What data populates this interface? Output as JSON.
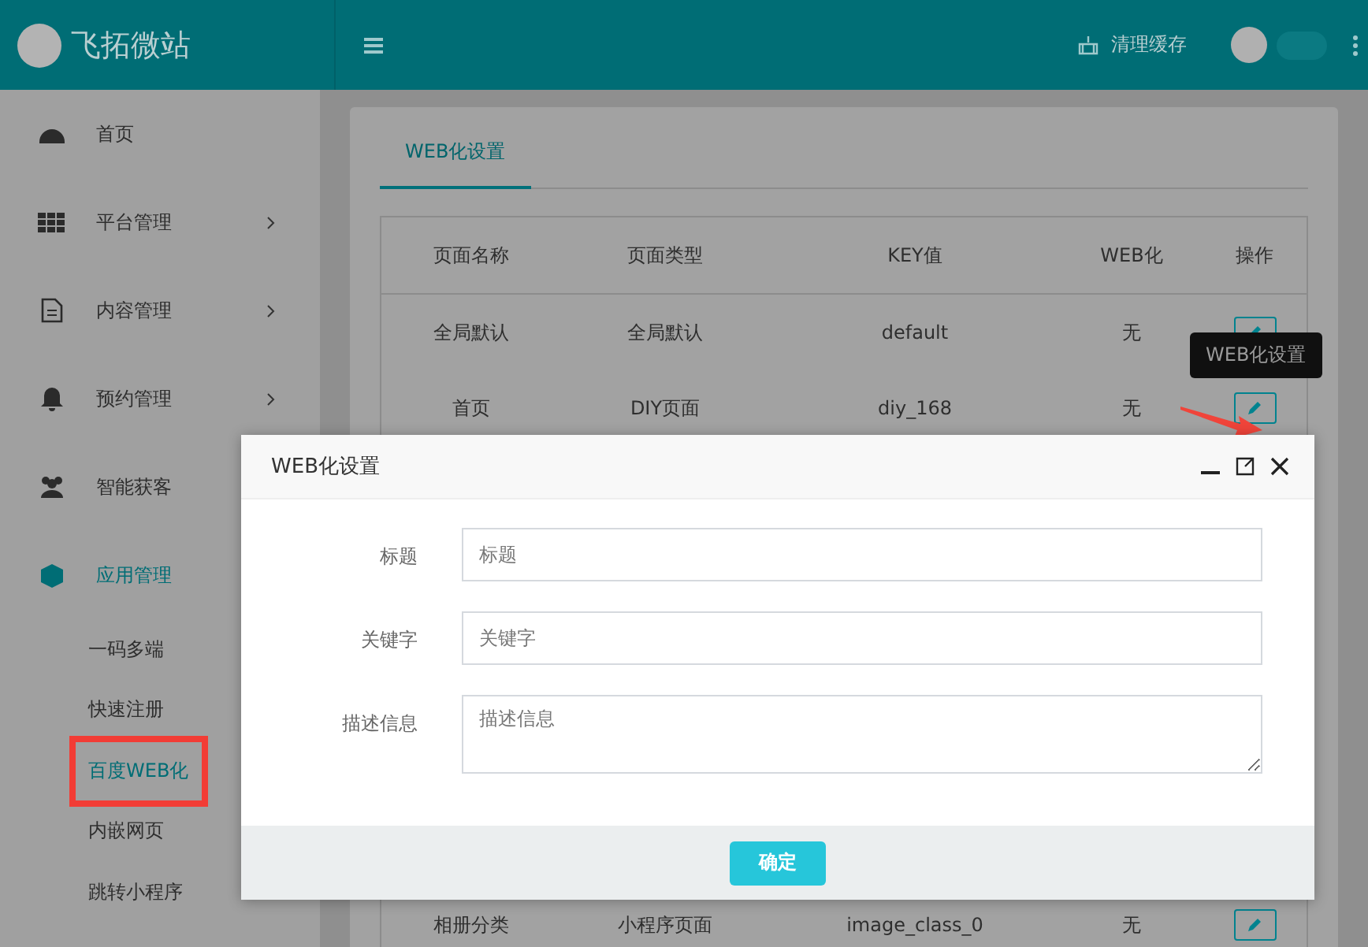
{
  "header": {
    "logo_text": "飞拓微站",
    "clear_cache": "清理缓存"
  },
  "sidebar": {
    "items": [
      {
        "label": "首页",
        "kind": "dashboard",
        "chevron": false,
        "selected": false
      },
      {
        "label": "平台管理",
        "kind": "grid",
        "chevron": true,
        "selected": false
      },
      {
        "label": "内容管理",
        "kind": "document",
        "chevron": true,
        "selected": false
      },
      {
        "label": "预约管理",
        "kind": "bell",
        "chevron": true,
        "selected": false
      },
      {
        "label": "智能获客",
        "kind": "users",
        "selected": false
      },
      {
        "label": "应用管理",
        "kind": "cube",
        "chevron": false,
        "selected": true,
        "children": [
          {
            "label": "一码多端",
            "selected": false,
            "highlighted": false
          },
          {
            "label": "快速注册",
            "selected": false,
            "highlighted": false
          },
          {
            "label": "百度WEB化",
            "selected": true,
            "highlighted": true
          },
          {
            "label": "内嵌网页",
            "selected": false,
            "highlighted": false
          },
          {
            "label": "跳转小程序",
            "selected": false,
            "highlighted": false
          }
        ]
      }
    ]
  },
  "tabs": [
    {
      "label": "WEB化设置",
      "selected": true
    }
  ],
  "table": {
    "columns": [
      "页面名称",
      "页面类型",
      "KEY值",
      "WEB化",
      "操作"
    ],
    "rows": [
      {
        "cells": [
          "全局默认",
          "全局默认",
          "default",
          "无"
        ]
      },
      {
        "cells": [
          "首页",
          "DIY页面",
          "diy_168",
          "无"
        ],
        "tooltip": "WEB化设置"
      }
    ],
    "last_row": {
      "cells": [
        "相册分类",
        "小程序页面",
        "image_class_0",
        "无"
      ]
    }
  },
  "dialog": {
    "title": "WEB化设置",
    "fields": [
      {
        "label": "标题",
        "placeholder": "标题",
        "kind": "input"
      },
      {
        "label": "关键字",
        "placeholder": "关键字",
        "kind": "input"
      },
      {
        "label": "描述信息",
        "placeholder": "描述信息",
        "kind": "textarea"
      }
    ],
    "confirm": "确定"
  }
}
